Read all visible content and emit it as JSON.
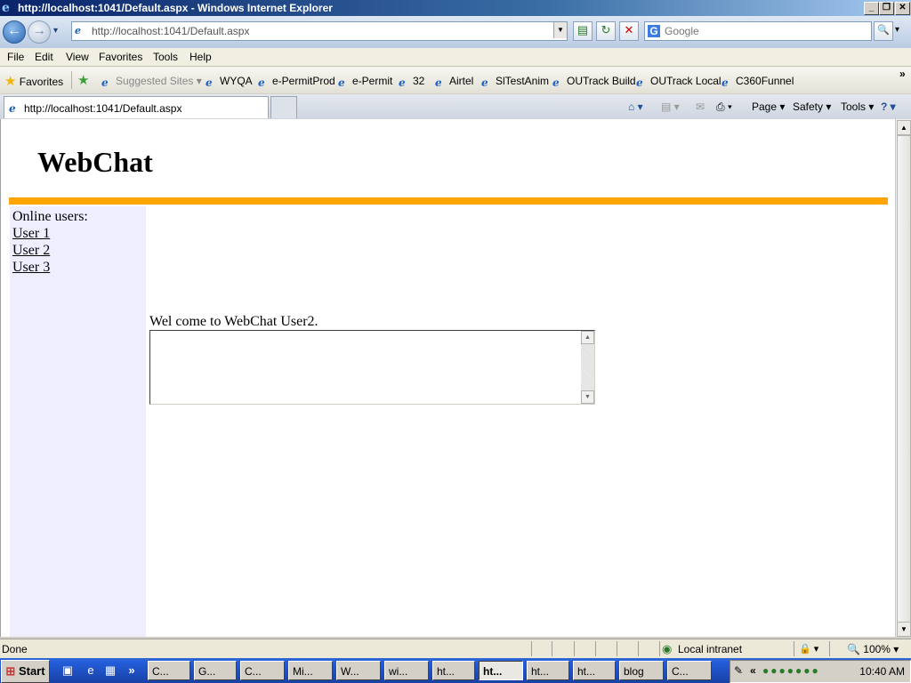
{
  "window": {
    "title": "http://localhost:1041/Default.aspx - Windows Internet Explorer",
    "caption_buttons": [
      "_",
      "❐",
      "✕"
    ]
  },
  "nav": {
    "back_glyph": "←",
    "forward_glyph": "→",
    "recent_glyph": "▾",
    "address": "http://localhost:1041/Default.aspx",
    "refresh_glyph": "↻",
    "stop_glyph": "✕",
    "compat_glyph": "▤",
    "search_placeholder": "Google",
    "search_logo": "G",
    "search_go_glyph": "🔍",
    "search_dd_glyph": "▾"
  },
  "menu": [
    "File",
    "Edit",
    "View",
    "Favorites",
    "Tools",
    "Help"
  ],
  "favorites_bar": {
    "favorites_label": "Favorites",
    "suggested_sites": "Suggested Sites ▾",
    "items": [
      "WYQA",
      "e-PermitProd",
      "e-Permit",
      "32",
      "Airtel",
      "SlTestAnim",
      "OUTrack Build",
      "OUTrack Local",
      "C360Funnel"
    ],
    "overflow": "»"
  },
  "tabs": {
    "active_tab": "http://localhost:1041/Default.aspx",
    "commands": {
      "home": "⌂ ▾",
      "feeds": "▤ ▾",
      "mail": "✉",
      "print": "⎙ ▾",
      "page": "Page ▾",
      "safety": "Safety ▾",
      "tools": "Tools ▾",
      "help": "? ▾"
    }
  },
  "page": {
    "heading": "WebChat",
    "online_label": "Online users:",
    "users": [
      "User 1",
      "User 2",
      "User 3"
    ],
    "welcome": "Wel come to WebChat User2.",
    "chat_value": ""
  },
  "statusbar": {
    "status": "Done",
    "zone": "Local intranet",
    "protected_mode": "🔒 ▾",
    "zoom": "🔍 100% ▾"
  },
  "taskbar": {
    "start": "Start",
    "quicklaunch_overflow": "»",
    "buttons": [
      {
        "label": "C...",
        "active": false
      },
      {
        "label": "G...",
        "active": false
      },
      {
        "label": "C...",
        "active": false
      },
      {
        "label": "Mi...",
        "active": false
      },
      {
        "label": "W...",
        "active": false
      },
      {
        "label": "wi...",
        "active": false
      },
      {
        "label": "ht...",
        "active": false
      },
      {
        "label": "ht...",
        "active": true
      },
      {
        "label": "ht...",
        "active": false
      },
      {
        "label": "ht...",
        "active": false
      },
      {
        "label": "blog",
        "active": false
      },
      {
        "label": "C...",
        "active": false
      }
    ],
    "tray_collapse": "«",
    "clock": "10:40 AM"
  },
  "colors": {
    "accent_bar": "#ffa500",
    "sidebar_bg": "#eeeeff",
    "taskbar": "#245edb"
  }
}
